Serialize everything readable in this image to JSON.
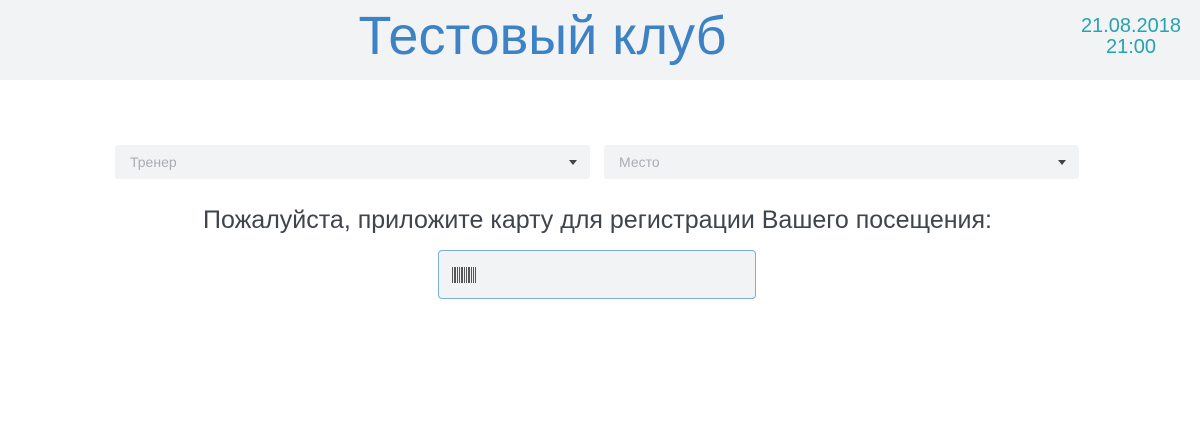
{
  "header": {
    "title": "Тестовый клуб",
    "date": "21.08.2018",
    "time": "21:00"
  },
  "filters": {
    "trainer_placeholder": "Тренер",
    "place_placeholder": "Место"
  },
  "prompt": "Пожалуйста, приложите карту для регистрации Вашего посещения:",
  "card_input": {
    "value": "",
    "icon": "barcode-icon"
  },
  "colors": {
    "title": "#3d82c4",
    "datetime": "#27a3b0",
    "header_bg": "#f2f3f5",
    "input_border": "#7aaedd"
  }
}
